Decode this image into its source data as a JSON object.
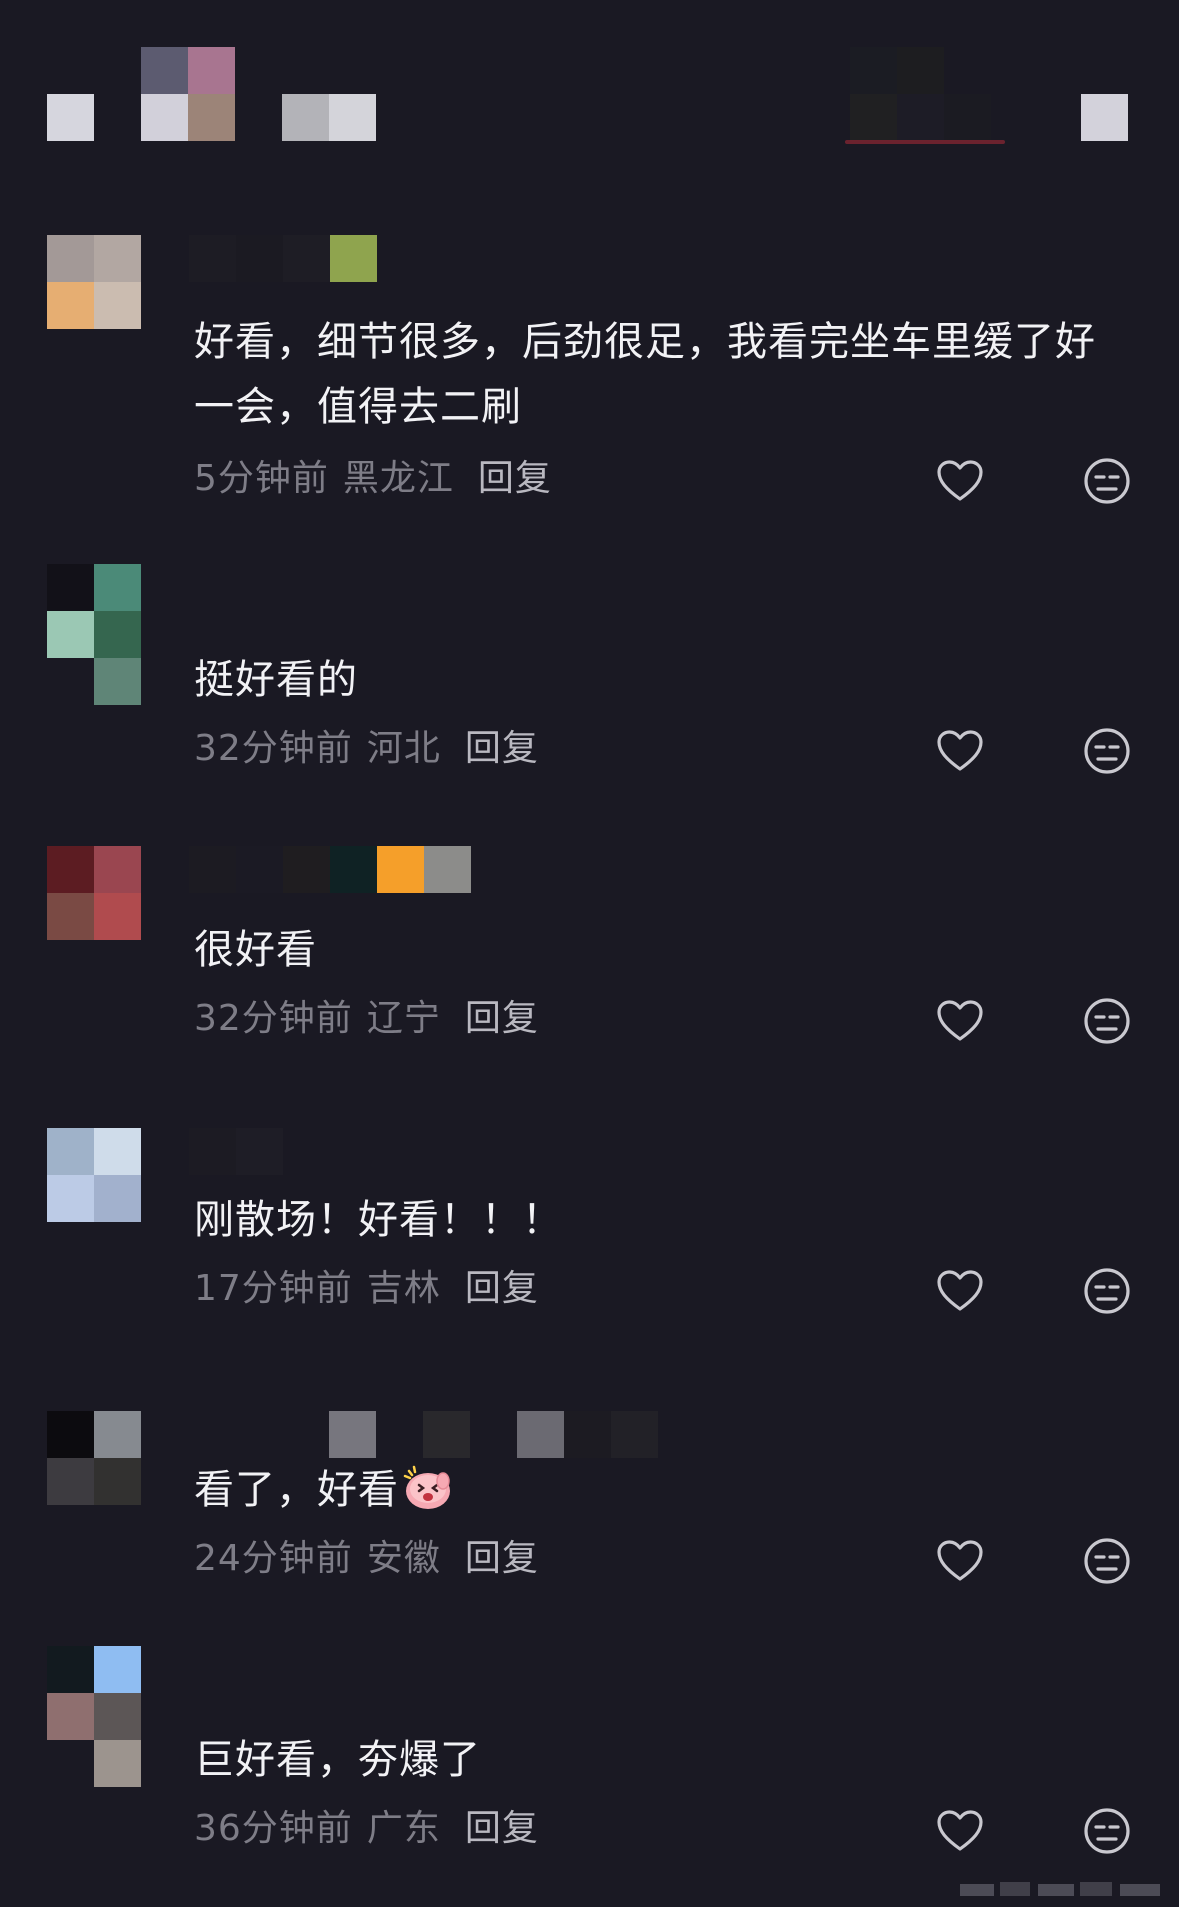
{
  "colors": {
    "background": "#1a1923",
    "text": "#f2f2f5",
    "meta": "#7e7d87",
    "reply": "#b9b8c0",
    "icon": "#c9c8cf"
  },
  "comments": [
    {
      "text": "好看，细节很多，后劲很足，我看完坐车里缓了好一会，值得去二刷",
      "time": "5分钟前",
      "location": "黑龙江",
      "reply_label": "回复",
      "like_icon": "heart-outline-icon",
      "dislike_icon": "neutral-face-icon"
    },
    {
      "text": "挺好看的",
      "time": "32分钟前",
      "location": "河北",
      "reply_label": "回复",
      "like_icon": "heart-outline-icon",
      "dislike_icon": "neutral-face-icon"
    },
    {
      "text": "很好看",
      "time": "32分钟前",
      "location": "辽宁",
      "reply_label": "回复",
      "like_icon": "heart-outline-icon",
      "dislike_icon": "neutral-face-icon"
    },
    {
      "text": "刚散场！好看！！！",
      "time": "17分钟前",
      "location": "吉林",
      "reply_label": "回复",
      "like_icon": "heart-outline-icon",
      "dislike_icon": "neutral-face-icon"
    },
    {
      "text": "看了，好看",
      "emoji": "excited-face-emoji",
      "time": "24分钟前",
      "location": "安徽",
      "reply_label": "回复",
      "like_icon": "heart-outline-icon",
      "dislike_icon": "neutral-face-icon"
    },
    {
      "text": "巨好看，夯爆了",
      "time": "36分钟前",
      "location": "广东",
      "reply_label": "回复",
      "like_icon": "heart-outline-icon",
      "dislike_icon": "neutral-face-icon"
    }
  ]
}
